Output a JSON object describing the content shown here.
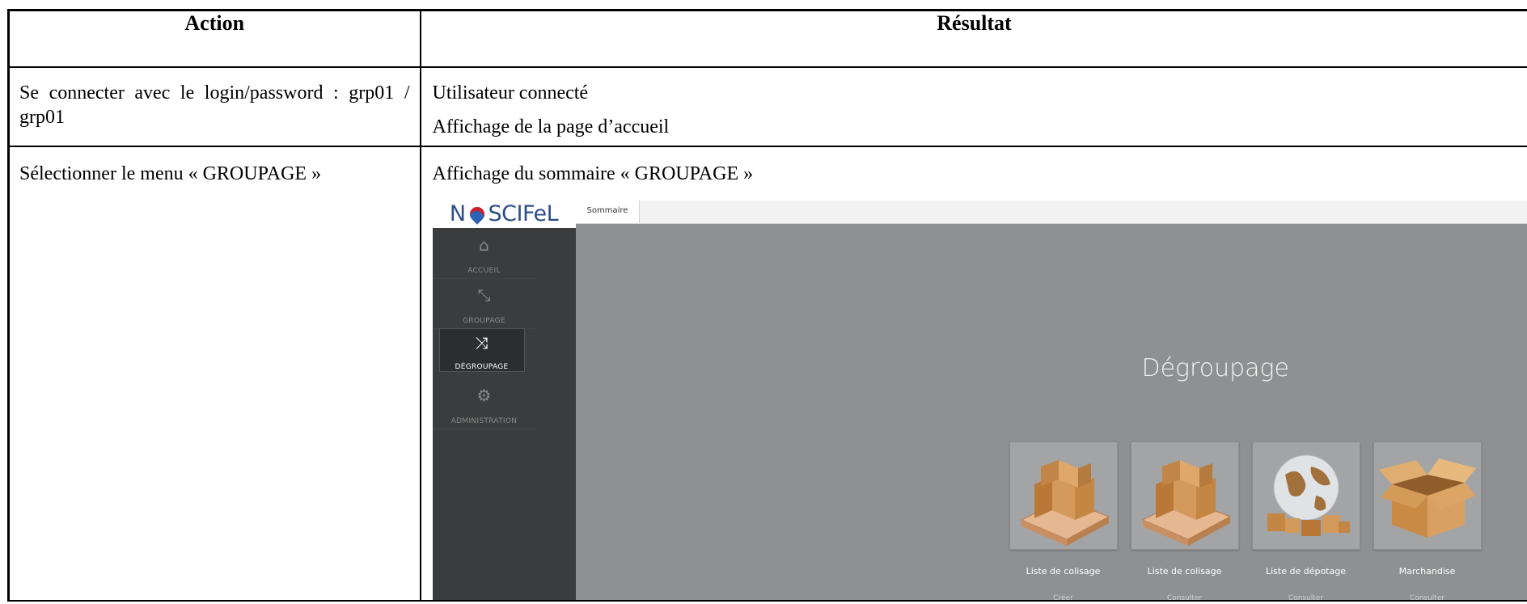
{
  "table": {
    "headers": {
      "action": "Action",
      "result": "Résultat"
    },
    "rows": [
      {
        "action": "Se connecter avec le login/password : grp01 / grp01",
        "results": [
          "Utilisateur connecté",
          "Affichage de la page d’accueil"
        ]
      },
      {
        "action": "Sélectionner le menu « GROUPAGE »",
        "results": [
          "Affichage du sommaire « GROUPAGE »"
        ]
      }
    ]
  },
  "app": {
    "logo": {
      "left": "N",
      "right": "SCIFeL"
    },
    "tab": "Sommaire",
    "sidebar": [
      {
        "icon": "home-icon",
        "glyph": "⌂",
        "label": "ACCUEIL"
      },
      {
        "icon": "compress-icon",
        "glyph": "⤡",
        "label": "GROUPAGE"
      },
      {
        "icon": "shuffle-icon",
        "glyph": "⤨",
        "label": "DÉGROUPAGE",
        "active": true
      },
      {
        "icon": "gears-icon",
        "glyph": "⚙",
        "label": "ADMINISTRATION"
      }
    ],
    "heading": "Dégroupage",
    "tiles": [
      {
        "icon": "pallet-boxes-icon",
        "name": "Liste de colisage",
        "sub": "Créer"
      },
      {
        "icon": "pallet-boxes-icon",
        "name": "Liste de colisage",
        "sub": "Consulter"
      },
      {
        "icon": "globe-boxes-icon",
        "name": "Liste de dépotage",
        "sub": "Consulter"
      },
      {
        "icon": "open-box-icon",
        "name": "Marchandise",
        "sub": "Consulter"
      }
    ]
  },
  "colors": {
    "sidebar": "#3b3c3d",
    "content": "#8f9091",
    "box": "#d39a5c",
    "pallet": "#e6b892",
    "globe": "#dfe3e6"
  }
}
